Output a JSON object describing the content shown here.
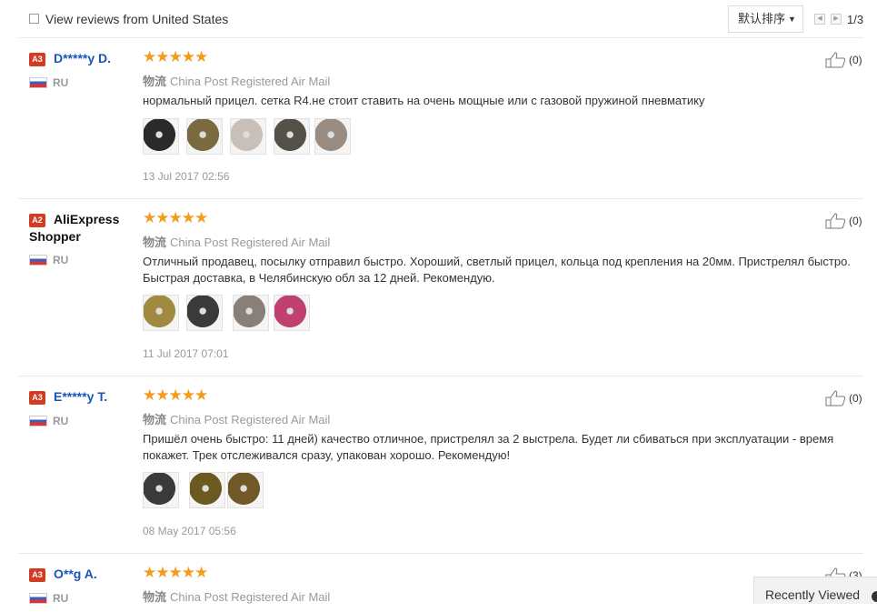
{
  "topbar": {
    "filter_label": "View reviews from United States",
    "sort_label": "默认排序",
    "page_indicator": "1/3"
  },
  "reviews": [
    {
      "badge": "A3",
      "name": "D*****y D.",
      "country": "RU",
      "stars": "★★★★★",
      "ship_prefix": "物流",
      "shipping": "China Post Registered Air Mail",
      "text": "нормальный прицел. сетка R4.не стоит ставить на очень мощные или с газовой пружиной пневматику",
      "date": "13 Jul 2017 02:56",
      "likes": "(0)",
      "thumb_colors": [
        "#2a2a2a",
        "#7a6a40",
        "#c8c0b8",
        "#555048",
        "#9a8c80"
      ]
    },
    {
      "badge": "A2",
      "name": "AliExpress Shopper",
      "country": "RU",
      "stars": "★★★★★",
      "ship_prefix": "物流",
      "shipping": "China Post Registered Air Mail",
      "text": "Отличный продавец, посылку отправил быстро. Хороший, светлый прицел, кольца под крепления на 20мм. Пристрелял быстро. Быстрая доставка, в Челябинскую обл за 12 дней. Рекомендую.",
      "date": "11 Jul 2017 07:01",
      "likes": "(0)",
      "thumb_colors": [
        "#a08a40",
        "#3a3a38",
        "#888078",
        "#c04070"
      ]
    },
    {
      "badge": "A3",
      "name": "E*****y T.",
      "country": "RU",
      "stars": "★★★★★",
      "ship_prefix": "物流",
      "shipping": "China Post Registered Air Mail",
      "text": "Пришёл очень быстро: 11 дней) качество отличное, пристрелял за 2 выстрела. Будет ли сбиваться при эксплуатации - время покажет. Трек отслеживался сразу, упакован хорошо. Рекомендую!",
      "date": "08 May 2017 05:56",
      "likes": "(0)",
      "thumb_colors": [
        "#3a3a3a",
        "#6a5a20",
        "#705828"
      ]
    },
    {
      "badge": "A3",
      "name": "O**g A.",
      "country": "RU",
      "stars": "★★★★★",
      "ship_prefix": "物流",
      "shipping": "China Post Registered Air Mail",
      "likes": "(3)"
    }
  ],
  "recently_viewed": "Recently Viewed"
}
